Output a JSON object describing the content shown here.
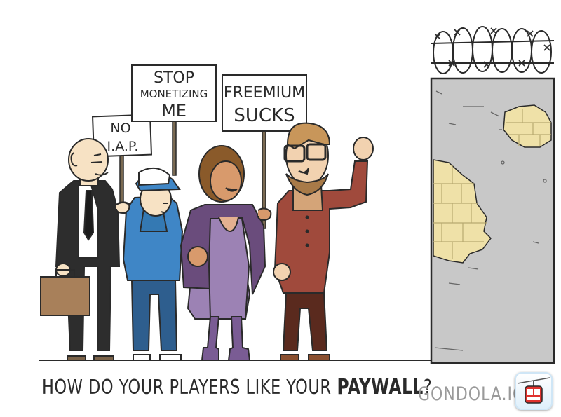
{
  "signs": {
    "no_iap_line1": "NO",
    "no_iap_line2": "I.A.P.",
    "stop_line1": "STOP",
    "stop_line2": "MONETIZING",
    "stop_line3": "ME",
    "freemium_line1": "FREEMIUM",
    "freemium_line2": "SUCKS"
  },
  "caption": {
    "text": "HOW DO YOUR PLAYERS LIKE YOUR",
    "emphasis": "PAYWALL",
    "question_mark": "?"
  },
  "brand": {
    "name": "GONDOLA.IO",
    "icon": "gondola-app-icon"
  },
  "colors": {
    "wall": "#c8c8c8",
    "bricks": "#efe1a8",
    "hoodie": "#3f86c6",
    "coat": "#a04a3c",
    "dress": "#9c82b4",
    "jacket": "#6a4c7c",
    "briefcase": "#a8805a"
  }
}
